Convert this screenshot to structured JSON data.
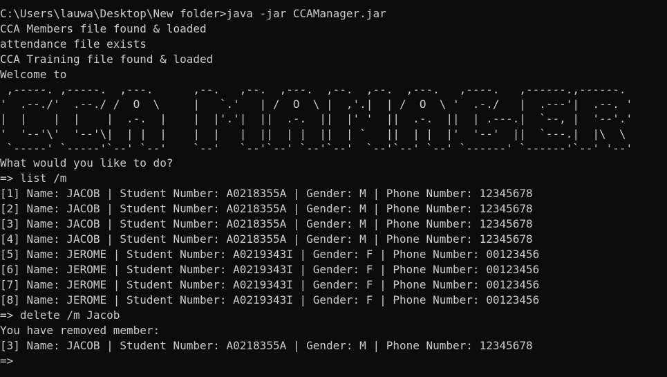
{
  "terminal": {
    "command_line": "C:\\Users\\lauwa\\Desktop\\New folder>java -jar CCAManager.jar",
    "status_lines": [
      "CCA Members file found & loaded",
      "attendance file exists",
      "CCA Training file found & loaded",
      "Welcome to"
    ],
    "banner_lines": [
      " ,-----. ,-----.  ,---.      ,--.   ,--.  ,---.  ,--.  ,--.  ,---.   ,----.   ,------.,------.",
      "'  .--./'  .--./ /  O  \\     |   `.'   | /  O  \\ |  ,'.|  | /  O  \\ '  .-./   |  .---'|  .--. '",
      "|  |    |  |    |  .-.  |    |  |'.'|  ||  .-.  ||  |' '  ||  .-.  ||  | .---.|  `--, |  '--'.'",
      "'  '--'\\'  '--'\\|  | |  |    |  |   |  ||  | |  ||  | `   ||  | |  |'  '--'  ||  `---.|  |\\  \\ ",
      " `-----' `-----'`--' `--'    `--'   `--'`--' `--'`--'  `--'`--' `--' `------' `------'`--' '--'"
    ],
    "prompt_question": "What would you like to do?",
    "command_list": "=> list /m",
    "member_rows": [
      "[1] Name: JACOB | Student Number: A0218355A | Gender: M | Phone Number: 12345678",
      "[2] Name: JACOB | Student Number: A0218355A | Gender: M | Phone Number: 12345678",
      "[3] Name: JACOB | Student Number: A0218355A | Gender: M | Phone Number: 12345678",
      "[4] Name: JACOB | Student Number: A0218355A | Gender: M | Phone Number: 12345678",
      "[5] Name: JEROME | Student Number: A0219343I | Gender: F | Phone Number: 00123456",
      "[6] Name: JEROME | Student Number: A0219343I | Gender: F | Phone Number: 00123456",
      "[7] Name: JEROME | Student Number: A0219343I | Gender: F | Phone Number: 00123456",
      "[8] Name: JEROME | Student Number: A0219343I | Gender: F | Phone Number: 00123456"
    ],
    "command_delete": "=> delete /m Jacob",
    "removed_message": "You have removed member:",
    "removed_row": "[3] Name: JACOB | Student Number: A0218355A | Gender: M | Phone Number: 12345678",
    "final_prompt": "=>"
  },
  "colors": {
    "background": "#0c0c0c",
    "text": "#cccccc"
  }
}
